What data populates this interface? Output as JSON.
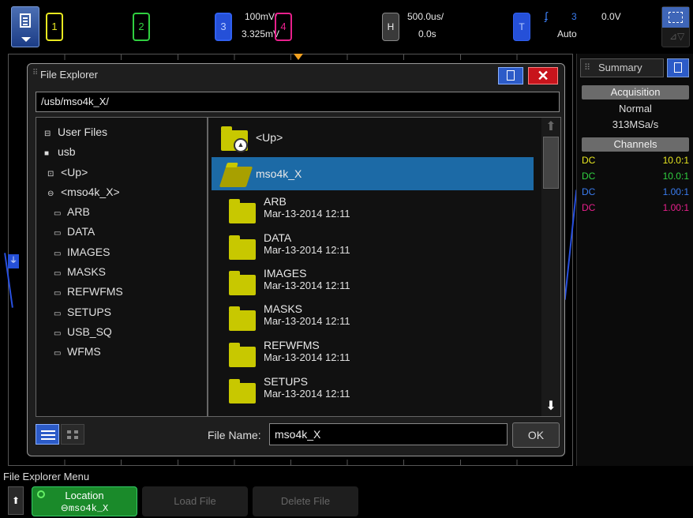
{
  "colors": {
    "ch1": "#e8e820",
    "ch2": "#30d040",
    "ch3": "#3a7cf0",
    "ch4": "#e8208c",
    "selection": "#1c6aa6",
    "folder": "#c8c800",
    "softkey_active": "#1a8a2a",
    "close": "#c8141c"
  },
  "topbar": {
    "ch1_label": "1",
    "ch2_label": "2",
    "ch3_label": "3",
    "ch3_scale": "100mV/",
    "ch3_offset": "3.325mV",
    "ch4_label": "4",
    "h_label": "H",
    "time_scale": "500.0us/",
    "time_delay": "0.0s",
    "t_label": "T",
    "trigger_slope_icon": "rising-edge-icon",
    "trigger_source": "3",
    "trigger_level": "0.0V",
    "trigger_mode": "Auto"
  },
  "summary": {
    "tab_label": "Summary",
    "acquisition_header": "Acquisition",
    "acq_mode": "Normal",
    "sample_rate": "313MSa/s",
    "channels_header": "Channels",
    "channels": [
      {
        "coupling": "DC",
        "ratio": "10.0:1",
        "color": "#e8e820"
      },
      {
        "coupling": "DC",
        "ratio": "10.0:1",
        "color": "#30d040"
      },
      {
        "coupling": "DC",
        "ratio": "1.00:1",
        "color": "#3a7cf0"
      },
      {
        "coupling": "DC",
        "ratio": "1.00:1",
        "color": "#e8208c"
      }
    ]
  },
  "dialog": {
    "title": "File Explorer",
    "path": "/usb/mso4k_X/",
    "tree": [
      {
        "icon": "drive-icon",
        "label": "User Files"
      },
      {
        "icon": "usb-icon",
        "label": "usb"
      },
      {
        "icon": "folder-up-icon",
        "label": "<Up>"
      },
      {
        "icon": "folder-open-icon",
        "label": "<mso4k_X>"
      },
      {
        "icon": "folder-icon",
        "label": "ARB"
      },
      {
        "icon": "folder-icon",
        "label": "DATA"
      },
      {
        "icon": "folder-icon",
        "label": "IMAGES"
      },
      {
        "icon": "folder-icon",
        "label": "MASKS"
      },
      {
        "icon": "folder-icon",
        "label": "REFWFMS"
      },
      {
        "icon": "folder-icon",
        "label": "SETUPS"
      },
      {
        "icon": "folder-icon",
        "label": "USB_SQ"
      },
      {
        "icon": "folder-icon",
        "label": "WFMS"
      }
    ],
    "up_label": "<Up>",
    "selected_folder": "mso4k_X",
    "files": [
      {
        "name": "ARB",
        "date": "Mar-13-2014 12:11"
      },
      {
        "name": "DATA",
        "date": "Mar-13-2014 12:11"
      },
      {
        "name": "IMAGES",
        "date": "Mar-13-2014 12:11"
      },
      {
        "name": "MASKS",
        "date": "Mar-13-2014 12:11"
      },
      {
        "name": "REFWFMS",
        "date": "Mar-13-2014 12:11"
      },
      {
        "name": "SETUPS",
        "date": "Mar-13-2014 12:11"
      }
    ],
    "file_name_label": "File Name:",
    "file_name_value": "mso4k_X",
    "ok_label": "OK"
  },
  "menu": {
    "title": "File Explorer Menu",
    "location_label": "Location",
    "location_value": "⊖mso4k_X",
    "load_label": "Load File",
    "delete_label": "Delete File"
  }
}
